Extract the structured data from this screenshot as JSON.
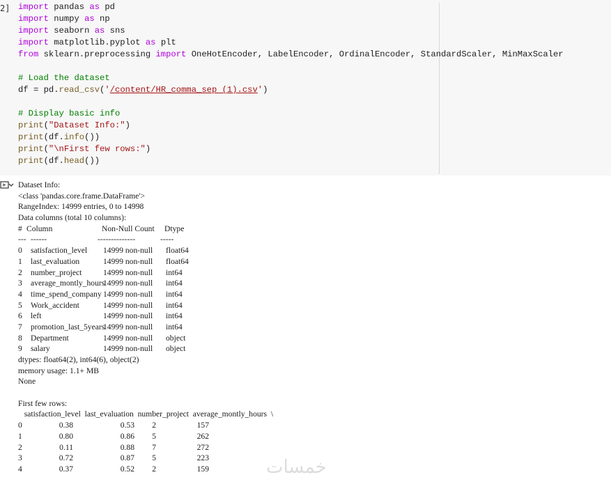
{
  "cell": {
    "execution_count": "2]",
    "code": {
      "l1": {
        "kw1": "import",
        "mod": " pandas ",
        "kw2": "as",
        "alias": " pd"
      },
      "l2": {
        "kw1": "import",
        "mod": " numpy ",
        "kw2": "as",
        "alias": " np"
      },
      "l3": {
        "kw1": "import",
        "mod": " seaborn ",
        "kw2": "as",
        "alias": " sns"
      },
      "l4": {
        "kw1": "import",
        "mod": " matplotlib.pyplot ",
        "kw2": "as",
        "alias": " plt"
      },
      "l5": {
        "kw1": "from",
        "mod": " sklearn.preprocessing ",
        "kw2": "import",
        "rest": " OneHotEncoder, LabelEncoder, OrdinalEncoder, StandardScaler, MinMaxScaler"
      },
      "c1": "# Load the dataset",
      "l6": {
        "pre": "df = pd.",
        "fn": "read_csv",
        "open": "(",
        "q1": "'",
        "path": "/content/HR_comma_sep (1).csv",
        "q2": "'",
        "close": ")"
      },
      "c2": "# Display basic info",
      "l7": {
        "fn": "print",
        "open": "(",
        "str": "\"Dataset Info:\"",
        "close": ")"
      },
      "l8": {
        "fn": "print",
        "open": "(",
        "mid": "df.",
        "fn2": "info",
        "close": "())"
      },
      "l9": {
        "fn": "print",
        "open": "(",
        "str": "\"\\nFirst few rows:\"",
        "close": ")"
      },
      "l10": {
        "fn": "print",
        "open": "(",
        "mid": "df.",
        "fn2": "head",
        "close": "())"
      }
    }
  },
  "output": {
    "lines": [
      "Dataset Info:",
      "<class 'pandas.core.frame.DataFrame'>",
      "RangeIndex: 14999 entries, 0 to 14998",
      "Data columns (total 10 columns):"
    ],
    "info_header": {
      "idx": "#",
      "name": "Column",
      "count": "Non-Null Count",
      "dtype": "Dtype"
    },
    "info_sep": {
      "idx": "---",
      "name": "------",
      "count": "--------------",
      "dtype": "-----"
    },
    "info_rows": [
      {
        "i": "0",
        "name": "satisfaction_level",
        "count": "14999 non-null",
        "dtype": "float64"
      },
      {
        "i": "1",
        "name": "last_evaluation",
        "count": "14999 non-null",
        "dtype": "float64"
      },
      {
        "i": "2",
        "name": "number_project",
        "count": "14999 non-null",
        "dtype": "int64"
      },
      {
        "i": "3",
        "name": "average_montly_hours",
        "count": "14999 non-null",
        "dtype": "int64"
      },
      {
        "i": "4",
        "name": "time_spend_company",
        "count": "14999 non-null",
        "dtype": "int64"
      },
      {
        "i": "5",
        "name": "Work_accident",
        "count": "14999 non-null",
        "dtype": "int64"
      },
      {
        "i": "6",
        "name": "left",
        "count": "14999 non-null",
        "dtype": "int64"
      },
      {
        "i": "7",
        "name": "promotion_last_5years",
        "count": "14999 non-null",
        "dtype": "int64"
      },
      {
        "i": "8",
        "name": "Department",
        "count": "14999 non-null",
        "dtype": "object"
      },
      {
        "i": "9",
        "name": "salary",
        "count": "14999 non-null",
        "dtype": "object"
      }
    ],
    "dtypes": "dtypes: float64(2), int64(6), object(2)",
    "memory": "memory usage: 1.1+ MB",
    "none": "None",
    "first_rows_title": "First few rows:",
    "df_header": "   satisfaction_level  last_evaluation  number_project  average_montly_hours  \\",
    "df_rows": [
      {
        "idx": "0",
        "sat": "0.38",
        "eval": "0.53",
        "proj": "2",
        "hours": "157"
      },
      {
        "idx": "1",
        "sat": "0.80",
        "eval": "0.86",
        "proj": "5",
        "hours": "262"
      },
      {
        "idx": "2",
        "sat": "0.11",
        "eval": "0.88",
        "proj": "7",
        "hours": "272"
      },
      {
        "idx": "3",
        "sat": "0.72",
        "eval": "0.87",
        "proj": "5",
        "hours": "223"
      },
      {
        "idx": "4",
        "sat": "0.37",
        "eval": "0.52",
        "proj": "2",
        "hours": "159"
      }
    ]
  },
  "watermark": "خمسات"
}
